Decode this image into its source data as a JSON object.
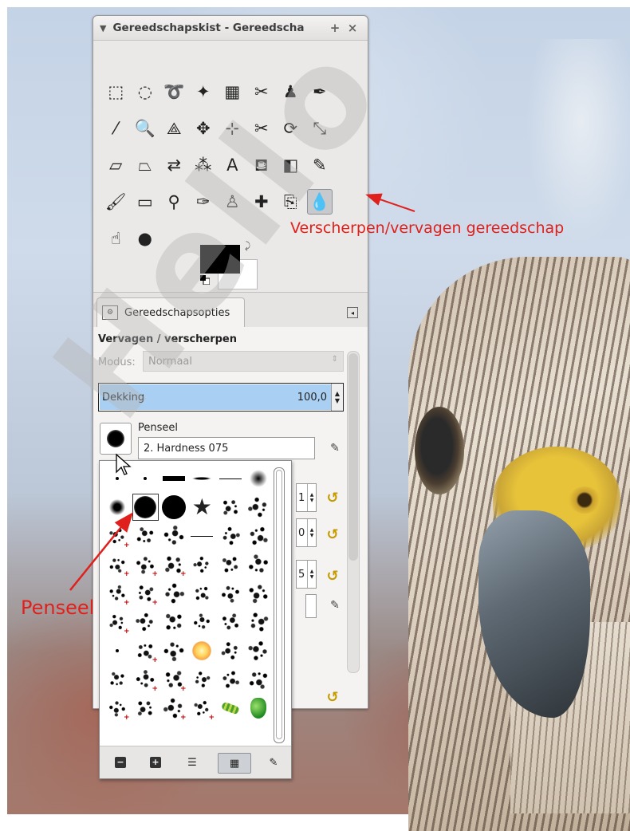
{
  "window": {
    "title": "Gereedschapskist - Gereedscha",
    "add_label": "+",
    "close_label": "×",
    "collapse_label": "▼"
  },
  "tools": [
    {
      "name": "rect-select-icon",
      "glyph": "⬚"
    },
    {
      "name": "ellipse-select-icon",
      "glyph": "◌"
    },
    {
      "name": "free-select-icon",
      "glyph": "➰"
    },
    {
      "name": "fuzzy-select-icon",
      "glyph": "✦"
    },
    {
      "name": "select-by-color-icon",
      "glyph": "▦"
    },
    {
      "name": "scissors-select-icon",
      "glyph": "✂"
    },
    {
      "name": "foreground-select-icon",
      "glyph": "♟"
    },
    {
      "name": "paths-icon",
      "glyph": "✒"
    },
    {
      "name": "color-picker-icon",
      "glyph": "⁄"
    },
    {
      "name": "zoom-icon",
      "glyph": "🔍"
    },
    {
      "name": "measure-icon",
      "glyph": "⟁"
    },
    {
      "name": "move-icon",
      "glyph": "✥"
    },
    {
      "name": "align-icon",
      "glyph": "⊹"
    },
    {
      "name": "crop-icon",
      "glyph": "✂"
    },
    {
      "name": "rotate-icon",
      "glyph": "⟳"
    },
    {
      "name": "scale-icon",
      "glyph": "⤡"
    },
    {
      "name": "shear-icon",
      "glyph": "▱"
    },
    {
      "name": "perspective-icon",
      "glyph": "⏢"
    },
    {
      "name": "flip-icon",
      "glyph": "⇄"
    },
    {
      "name": "cage-transform-icon",
      "glyph": "⁂"
    },
    {
      "name": "text-icon",
      "glyph": "A"
    },
    {
      "name": "bucket-fill-icon",
      "glyph": "⛾"
    },
    {
      "name": "blend-icon",
      "glyph": "◧"
    },
    {
      "name": "pencil-icon",
      "glyph": "✎"
    },
    {
      "name": "paintbrush-icon",
      "glyph": "🖌"
    },
    {
      "name": "eraser-icon",
      "glyph": "▭"
    },
    {
      "name": "airbrush-icon",
      "glyph": "⚲"
    },
    {
      "name": "ink-icon",
      "glyph": "✑"
    },
    {
      "name": "clone-icon",
      "glyph": "♙"
    },
    {
      "name": "heal-icon",
      "glyph": "✚"
    },
    {
      "name": "perspective-clone-icon",
      "glyph": "⎘"
    },
    {
      "name": "blur-sharpen-icon",
      "glyph": "💧",
      "active": true
    },
    {
      "name": "smudge-icon",
      "glyph": "☝"
    },
    {
      "name": "dodge-burn-icon",
      "glyph": "●"
    }
  ],
  "colors": {
    "fg": "#000000",
    "bg": "#ffffff"
  },
  "tab": {
    "label": "Gereedschapsopties"
  },
  "options": {
    "title": "Vervagen / verscherpen",
    "mode_label": "Modus:",
    "mode_value": "Normaal",
    "opacity_label": "Dekking",
    "opacity_value": "100,0",
    "brush_label": "Penseel",
    "brush_value": "2. Hardness 075",
    "spin_values": [
      "1",
      "0",
      "5"
    ]
  },
  "brushes": [
    {
      "k": "b-dot"
    },
    {
      "k": "b-dot"
    },
    {
      "k": "b-bar"
    },
    {
      "k": "b-bar2"
    },
    {
      "k": "b-line"
    },
    {
      "k": "b-soft"
    },
    {
      "k": "b-mid"
    },
    {
      "k": "b-big",
      "sel": true
    },
    {
      "k": "b-hard"
    },
    {
      "k": "b-star"
    },
    {
      "k": "b-tex"
    },
    {
      "k": "b-tex"
    },
    {
      "k": "b-tex",
      "p": 1
    },
    {
      "k": "b-tex"
    },
    {
      "k": "b-tex"
    },
    {
      "k": "b-line"
    },
    {
      "k": "b-tex"
    },
    {
      "k": "b-tex"
    },
    {
      "k": "b-tex",
      "p": 1
    },
    {
      "k": "b-tex",
      "p": 1
    },
    {
      "k": "b-tex",
      "p": 1
    },
    {
      "k": "b-tex"
    },
    {
      "k": "b-tex"
    },
    {
      "k": "b-tex"
    },
    {
      "k": "b-tex",
      "p": 1
    },
    {
      "k": "b-tex",
      "p": 1
    },
    {
      "k": "b-tex"
    },
    {
      "k": "b-tex"
    },
    {
      "k": "b-tex"
    },
    {
      "k": "b-tex"
    },
    {
      "k": "b-tex",
      "p": 1
    },
    {
      "k": "b-tex"
    },
    {
      "k": "b-tex"
    },
    {
      "k": "b-tex"
    },
    {
      "k": "b-tex"
    },
    {
      "k": "b-tex"
    },
    {
      "k": "b-dot"
    },
    {
      "k": "b-tex",
      "p": 1
    },
    {
      "k": "b-tex"
    },
    {
      "k": "b-glow"
    },
    {
      "k": "b-tex"
    },
    {
      "k": "b-tex"
    },
    {
      "k": "b-tex"
    },
    {
      "k": "b-tex",
      "p": 1
    },
    {
      "k": "b-tex",
      "p": 1
    },
    {
      "k": "b-tex"
    },
    {
      "k": "b-tex"
    },
    {
      "k": "b-tex"
    },
    {
      "k": "b-tex",
      "p": 1
    },
    {
      "k": "b-tex"
    },
    {
      "k": "b-tex",
      "p": 1
    },
    {
      "k": "b-tex",
      "p": 1
    },
    {
      "k": "b-worm"
    },
    {
      "k": "b-pepper"
    }
  ],
  "popup_footer": [
    {
      "name": "zoom-out-button",
      "glyph": "−"
    },
    {
      "name": "zoom-in-button",
      "glyph": "+"
    },
    {
      "name": "list-view-button",
      "glyph": "☰"
    },
    {
      "name": "grid-view-button",
      "glyph": "▦",
      "on": true
    },
    {
      "name": "edit-brush-button",
      "glyph": "✎"
    }
  ],
  "annotations": {
    "tool": "Verscherpen/vervagen gereedschap",
    "brush": "Penseel"
  },
  "watermark": "Hello"
}
